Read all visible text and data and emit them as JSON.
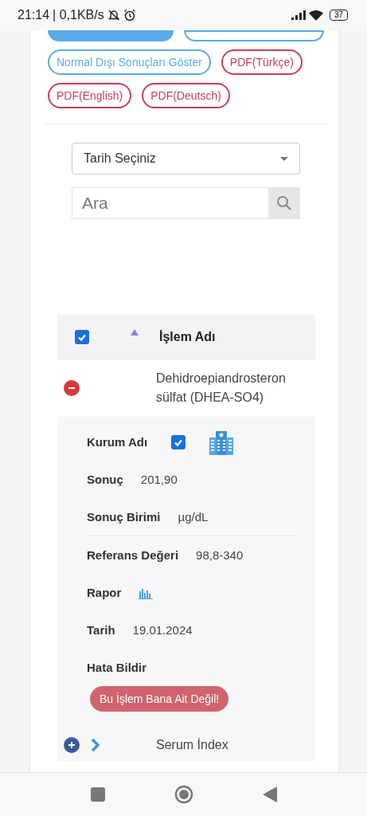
{
  "status_bar": {
    "time": "21:14",
    "network": "| 0,1KB/s",
    "battery": "37"
  },
  "filter_buttons": [
    {
      "kind": "filled"
    },
    {
      "kind": "info"
    },
    {
      "label": "Normal Dışı Sonuçları Göster",
      "kind": "info"
    },
    {
      "label": "PDF(Türkçe)",
      "kind": "danger"
    },
    {
      "label": "PDF(English)",
      "kind": "danger"
    },
    {
      "label": "PDF(Deutsch)",
      "kind": "danger"
    }
  ],
  "date_select": {
    "value": "Tarih Seçiniz"
  },
  "search": {
    "placeholder": "Ara"
  },
  "table": {
    "header": {
      "checked": true,
      "column": "İşlem Adı"
    },
    "rows": [
      {
        "name": "Dehidroepiandrosteron sülfat (DHEA-SO4)",
        "expanded": true,
        "details": [
          {
            "kind": "institution",
            "label": "Kurum Adı",
            "checked": true,
            "divider_after": false
          },
          {
            "kind": "text",
            "label": "Sonuç",
            "value": "201,90",
            "divider_after": false
          },
          {
            "kind": "text",
            "label": "Sonuç Birimi",
            "value": "µg/dL",
            "divider_after": true
          },
          {
            "kind": "text",
            "label": "Referans Değeri",
            "value": "98,8-340",
            "divider_after": false
          },
          {
            "kind": "chart",
            "label": "Rapor",
            "divider_after": false
          },
          {
            "kind": "text",
            "label": "Tarih",
            "value": "19.01.2024",
            "divider_after": false
          },
          {
            "kind": "report",
            "label": "Hata Bildir",
            "button": "Bu İşlem Bana Ait Değil!",
            "divider_after": false
          }
        ]
      },
      {
        "name": "Serum İndex",
        "expanded": false
      }
    ]
  }
}
